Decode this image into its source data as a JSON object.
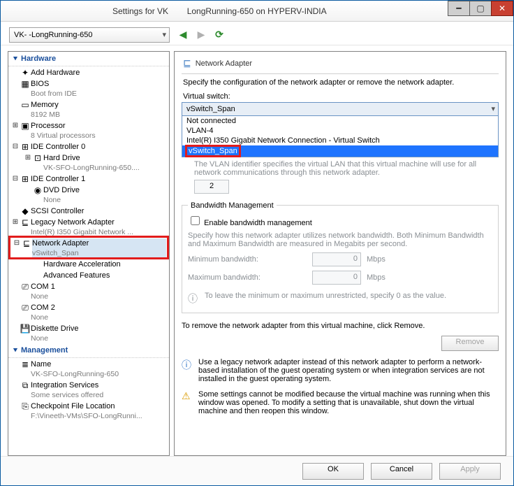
{
  "title": "Settings for VK        LongRunning-650 on HYPERV-INDIA",
  "vm_dropdown": "VK-        -LongRunning-650",
  "tree": {
    "hardware_header": "Hardware",
    "management_header": "Management",
    "items": [
      {
        "icon": "✦",
        "label": "Add Hardware"
      },
      {
        "icon": "▦",
        "label": "BIOS",
        "sub": "Boot from IDE"
      },
      {
        "icon": "▭",
        "label": "Memory",
        "sub": "8192 MB"
      },
      {
        "exp": "⊞",
        "icon": "▣",
        "label": "Processor",
        "sub": "8 Virtual processors"
      },
      {
        "exp": "⊟",
        "icon": "⊞",
        "label": "IDE Controller 0"
      },
      {
        "exp": "⊞",
        "icon": "⊡",
        "label": "Hard Drive",
        "sub": "VK-SFO-LongRunning-650....",
        "indent": 1
      },
      {
        "exp": "⊟",
        "icon": "⊞",
        "label": "IDE Controller 1"
      },
      {
        "icon": "◉",
        "label": "DVD Drive",
        "sub": "None",
        "indent": 1
      },
      {
        "icon": "◆",
        "label": "SCSI Controller"
      },
      {
        "exp": "⊞",
        "icon": "⊑",
        "label": "Legacy Network Adapter",
        "sub": "Intel(R) I350 Gigabit Network ..."
      },
      {
        "exp": "⊟",
        "icon": "⊑",
        "label": "Network Adapter",
        "sub": "vSwitch_Span",
        "selected": true,
        "hl": true
      },
      {
        "label": "Hardware Acceleration",
        "indent": 1
      },
      {
        "label": "Advanced Features",
        "indent": 1
      },
      {
        "icon": "⎚",
        "label": "COM 1",
        "sub": "None"
      },
      {
        "icon": "⎚",
        "label": "COM 2",
        "sub": "None"
      },
      {
        "icon": "💾",
        "label": "Diskette Drive",
        "sub": "None"
      }
    ],
    "mgmt": [
      {
        "icon": "≣",
        "label": "Name",
        "sub": "VK-SFO-LongRunning-650"
      },
      {
        "icon": "⧉",
        "label": "Integration Services",
        "sub": "Some services offered"
      },
      {
        "icon": "⎘",
        "label": "Checkpoint File Location",
        "sub": "F:\\Vineeth-VMs\\SFO-LongRunni..."
      }
    ]
  },
  "right": {
    "title": "Network Adapter",
    "desc": "Specify the configuration of the network adapter or remove the network adapter.",
    "switch_label": "Virtual switch:",
    "switch_value": "vSwitch_Span",
    "switch_options": [
      "Not connected",
      "VLAN-4",
      "Intel(R) I350 Gigabit Network Connection - Virtual Switch",
      "vSwitch_Span"
    ],
    "vlan_note": "The VLAN identifier specifies the virtual LAN that this virtual machine will use for all network communications through this network adapter.",
    "vlan_value": "2",
    "bw_header": "Bandwidth Management",
    "bw_checkbox": "Enable bandwidth management",
    "bw_note": "Specify how this network adapter utilizes network bandwidth. Both Minimum Bandwidth and Maximum Bandwidth are measured in Megabits per second.",
    "bw_min_label": "Minimum bandwidth:",
    "bw_min_value": "0",
    "bw_max_label": "Maximum bandwidth:",
    "bw_max_value": "0",
    "bw_unit": "Mbps",
    "bw_tip": "To leave the minimum or maximum unrestricted, specify 0 as the value.",
    "remove_note": "To remove the network adapter from this virtual machine, click Remove.",
    "remove_btn": "Remove",
    "info1": "Use a legacy network adapter instead of this network adapter to perform a network-based installation of the guest operating system or when integration services are not installed in the guest operating system.",
    "info2": "Some settings cannot be modified because the virtual machine was running when this window was opened. To modify a setting that is unavailable, shut down the virtual machine and then reopen this window."
  },
  "buttons": {
    "ok": "OK",
    "cancel": "Cancel",
    "apply": "Apply"
  }
}
